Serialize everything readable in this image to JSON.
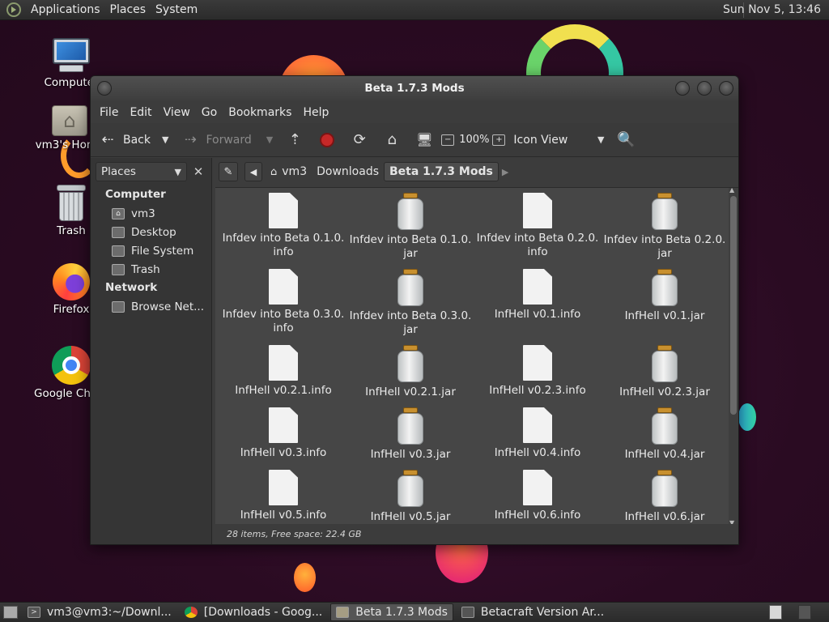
{
  "top_panel": {
    "menus": [
      "Applications",
      "Places",
      "System"
    ],
    "clock": "Sun Nov  5, 13:46"
  },
  "desktop": {
    "icons": [
      {
        "label": "Computer",
        "icon": "computer-icon"
      },
      {
        "label": "vm3's Home",
        "icon": "home-folder-icon"
      },
      {
        "label": "Trash",
        "icon": "trash-icon"
      },
      {
        "label": "Firefox",
        "icon": "firefox-icon"
      },
      {
        "label": "Google Chrome",
        "icon": "chrome-icon"
      }
    ]
  },
  "window": {
    "title": "Beta 1.7.3 Mods",
    "menu": [
      "File",
      "Edit",
      "View",
      "Go",
      "Bookmarks",
      "Help"
    ],
    "toolbar": {
      "back": "Back",
      "forward": "Forward",
      "zoom": "100%",
      "view_mode": "Icon View"
    },
    "sidepane": {
      "selector": "Places",
      "sections": [
        {
          "title": "Computer",
          "items": [
            {
              "label": "vm3",
              "icon": "home-icon"
            },
            {
              "label": "Desktop",
              "icon": "desktop-icon"
            },
            {
              "label": "File System",
              "icon": "drive-icon"
            },
            {
              "label": "Trash",
              "icon": "trash-icon"
            }
          ]
        },
        {
          "title": "Network",
          "items": [
            {
              "label": "Browse Net...",
              "icon": "network-icon"
            }
          ]
        }
      ]
    },
    "pathbar": [
      "vm3",
      "Downloads",
      "Beta 1.7.3 Mods"
    ],
    "files": [
      {
        "name": "Infdev into Beta 0.1.0.\ninfo",
        "type": "info"
      },
      {
        "name": "Infdev into Beta 0.1.0.\njar",
        "type": "jar"
      },
      {
        "name": "Infdev into Beta 0.2.0.\ninfo",
        "type": "info"
      },
      {
        "name": "Infdev into Beta 0.2.0.\njar",
        "type": "jar"
      },
      {
        "name": "Infdev into Beta 0.3.0.\ninfo",
        "type": "info"
      },
      {
        "name": "Infdev into Beta 0.3.0.\njar",
        "type": "jar"
      },
      {
        "name": "InfHell v0.1.info",
        "type": "info"
      },
      {
        "name": "InfHell v0.1.jar",
        "type": "jar"
      },
      {
        "name": "InfHell v0.2.1.info",
        "type": "info"
      },
      {
        "name": "InfHell v0.2.1.jar",
        "type": "jar"
      },
      {
        "name": "InfHell v0.2.3.info",
        "type": "info"
      },
      {
        "name": "InfHell v0.2.3.jar",
        "type": "jar"
      },
      {
        "name": "InfHell v0.3.info",
        "type": "info"
      },
      {
        "name": "InfHell v0.3.jar",
        "type": "jar"
      },
      {
        "name": "InfHell v0.4.info",
        "type": "info"
      },
      {
        "name": "InfHell v0.4.jar",
        "type": "jar"
      },
      {
        "name": "InfHell v0.5.info",
        "type": "info"
      },
      {
        "name": "InfHell v0.5.jar",
        "type": "jar"
      },
      {
        "name": "InfHell v0.6.info",
        "type": "info"
      },
      {
        "name": "InfHell v0.6.jar",
        "type": "jar"
      }
    ],
    "status": "28 items, Free space: 22.4 GB"
  },
  "taskbar": {
    "tasks": [
      {
        "label": "vm3@vm3:~/Downl...",
        "icon": "terminal-icon",
        "active": false
      },
      {
        "label": "[Downloads - Goog...",
        "icon": "chrome-icon",
        "active": false
      },
      {
        "label": "Beta 1.7.3 Mods",
        "icon": "folder-icon",
        "active": true
      },
      {
        "label": "Betacraft Version Ar...",
        "icon": "app-icon",
        "active": false
      }
    ]
  }
}
